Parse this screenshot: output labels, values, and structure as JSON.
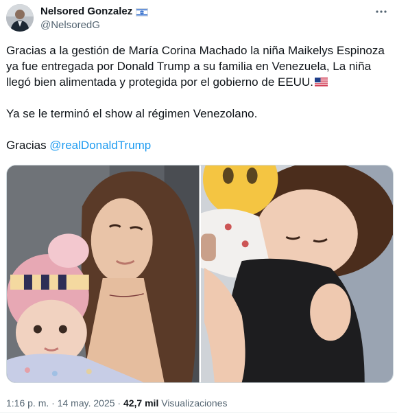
{
  "author": {
    "display_name": "Nelsored Gonzalez",
    "handle": "@NelsoredG",
    "badge": "israel-flag-icon"
  },
  "tweet": {
    "paragraph1": "Gracias a la gestión de María Corina Machado la niña Maikelys Espinoza ya fue entregada por Donald Trump a su familia en Venezuela, La niña llegó bien alimentada y protegida por el gobierno de EEUU.",
    "paragraph1_emoji": "us-flag-icon",
    "paragraph2": "Ya se le terminó el show al régimen Venezolano.",
    "paragraph3_prefix": "Gracias ",
    "mention": "@realDonaldTrump"
  },
  "media": {
    "photos": [
      {
        "name": "photo-woman-and-baby"
      },
      {
        "name": "photo-child-hugging"
      }
    ]
  },
  "meta": {
    "time": "1:16 p. m.",
    "separator": " · ",
    "date": "14 may. 2025",
    "views_count": "42,7 mil",
    "views_label": " Visualizaciones"
  },
  "colors": {
    "accent": "#1d9bf0",
    "text": "#0f1419",
    "secondary": "#536471"
  }
}
